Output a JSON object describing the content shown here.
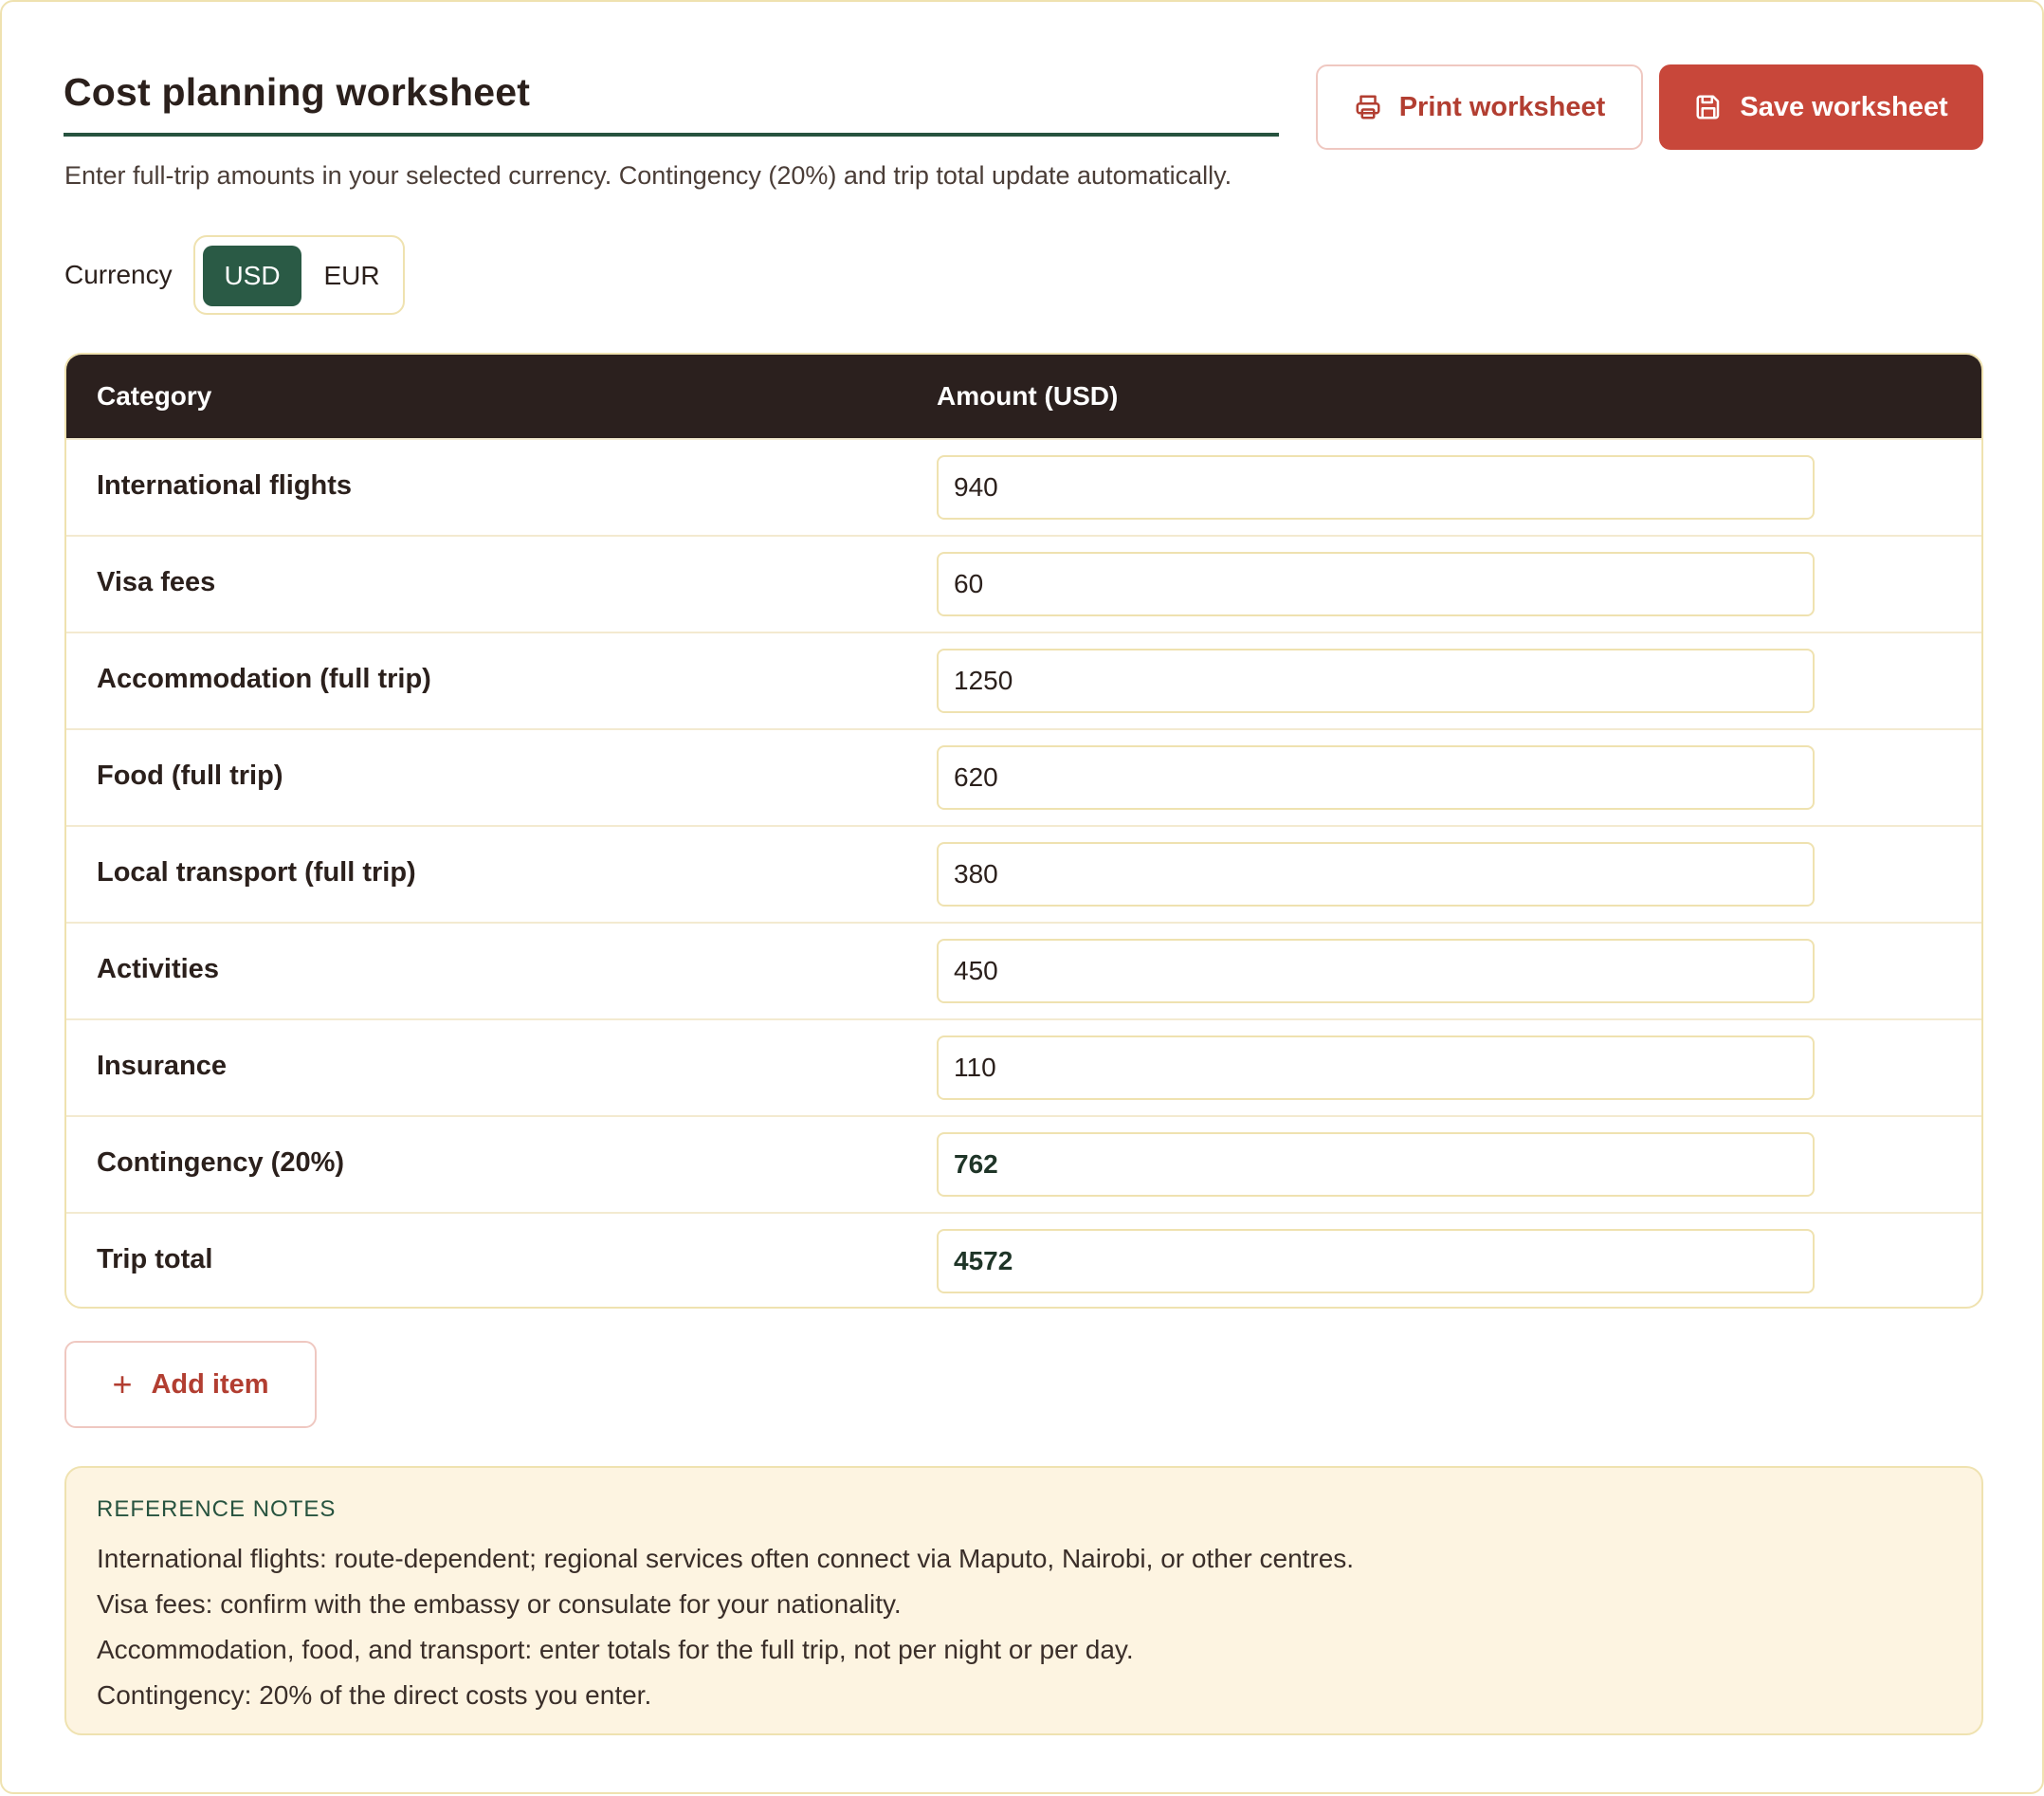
{
  "header": {
    "title": "Cost planning worksheet",
    "subtitle": "Enter full-trip amounts in your selected currency. Contingency (20%) and trip total update automatically."
  },
  "actions": {
    "print_label": "Print worksheet",
    "save_label": "Save worksheet",
    "print_icon": "printer-icon",
    "save_icon": "save-disk-icon"
  },
  "currency": {
    "label": "Currency",
    "options": [
      "USD",
      "EUR"
    ],
    "selected": "USD"
  },
  "table": {
    "headers": [
      "Category",
      "Amount (USD)"
    ],
    "rows": [
      {
        "category": "International flights",
        "amount": "940"
      },
      {
        "category": "Visa fees",
        "amount": "60"
      },
      {
        "category": "Accommodation (full trip)",
        "amount": "1250"
      },
      {
        "category": "Food (full trip)",
        "amount": "620"
      },
      {
        "category": "Local transport (full trip)",
        "amount": "380"
      },
      {
        "category": "Activities",
        "amount": "450"
      },
      {
        "category": "Insurance",
        "amount": "110"
      },
      {
        "category": "Contingency (20%)",
        "amount": "762"
      },
      {
        "category": "Trip total",
        "amount": "4572"
      }
    ]
  },
  "add_item": {
    "label": "Add item",
    "icon": "plus-icon"
  },
  "notes": {
    "heading": "REFERENCE NOTES",
    "lines": [
      "International flights: route-dependent; regional services often connect via Maputo, Nairobi, or other centres.",
      "Visa fees: confirm with the embassy or consulate for your nationality.",
      "Accommodation, food, and transport: enter totals for the full trip, not per night or per day.",
      "Contingency: 20% of the direct costs you enter."
    ]
  },
  "colors": {
    "accent_green": "#2a5a45",
    "accent_red": "#c8473a",
    "header_dark": "#2b201e",
    "border_cream": "#efe2b0",
    "notes_bg": "#fdf4e1"
  }
}
